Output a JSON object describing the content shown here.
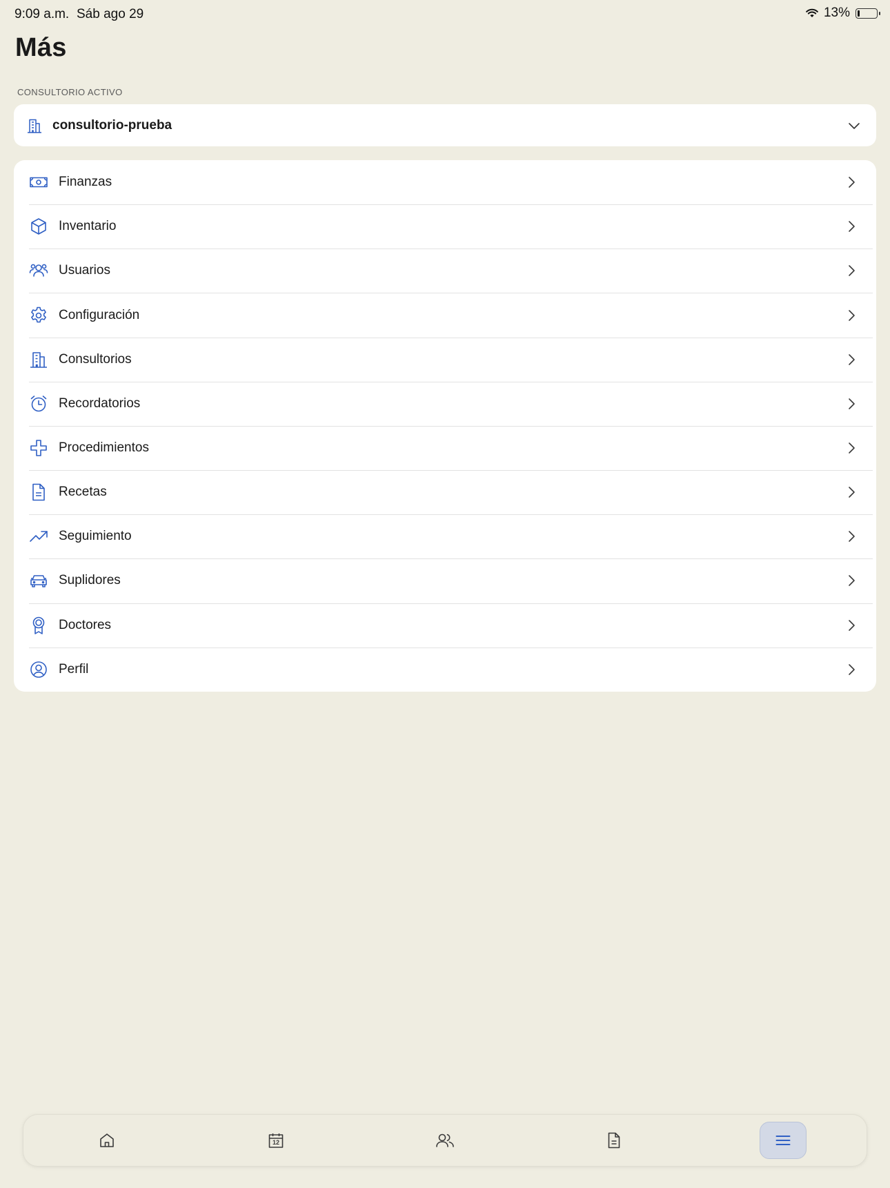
{
  "status_bar": {
    "time": "9:09 a.m.",
    "date": "Sáb ago 29",
    "battery_percent": "13%",
    "battery_level": 0.13
  },
  "page": {
    "title": "Más"
  },
  "active_office": {
    "section_label": "CONSULTORIO ACTIVO",
    "selected_value": "consultorio-prueba",
    "icon": "building-icon",
    "dropdown_icon": "chevron-down-icon"
  },
  "menu": {
    "items": [
      {
        "id": "finanzas",
        "label": "Finanzas",
        "icon": "banknote-icon"
      },
      {
        "id": "inventario",
        "label": "Inventario",
        "icon": "box-icon"
      },
      {
        "id": "usuarios",
        "label": "Usuarios",
        "icon": "users-icon"
      },
      {
        "id": "configuracion",
        "label": "Configuración",
        "icon": "gear-icon"
      },
      {
        "id": "consultorios",
        "label": "Consultorios",
        "icon": "building-icon"
      },
      {
        "id": "recordatorios",
        "label": "Recordatorios",
        "icon": "alarm-clock-icon"
      },
      {
        "id": "procedimientos",
        "label": "Procedimientos",
        "icon": "medical-cross-icon"
      },
      {
        "id": "recetas",
        "label": "Recetas",
        "icon": "document-icon"
      },
      {
        "id": "seguimiento",
        "label": "Seguimiento",
        "icon": "trending-up-icon"
      },
      {
        "id": "suplidores",
        "label": "Suplidores",
        "icon": "car-icon"
      },
      {
        "id": "doctores",
        "label": "Doctores",
        "icon": "award-icon"
      },
      {
        "id": "perfil",
        "label": "Perfil",
        "icon": "user-circle-icon"
      }
    ]
  },
  "tab_bar": {
    "tabs": [
      {
        "id": "home",
        "icon": "home-icon",
        "active": false
      },
      {
        "id": "calendar",
        "icon": "calendar-icon",
        "calendar_day": "12",
        "active": false
      },
      {
        "id": "patients",
        "icon": "users-icon",
        "active": false
      },
      {
        "id": "documents",
        "icon": "document-icon",
        "active": false
      },
      {
        "id": "more",
        "icon": "menu-icon",
        "active": true
      }
    ]
  },
  "colors": {
    "background": "#EFEDE1",
    "card": "#FFFFFF",
    "icon_accent": "#2F5FC4",
    "active_tab_bg": "#D3D9E6",
    "text": "#1A1A1A"
  }
}
